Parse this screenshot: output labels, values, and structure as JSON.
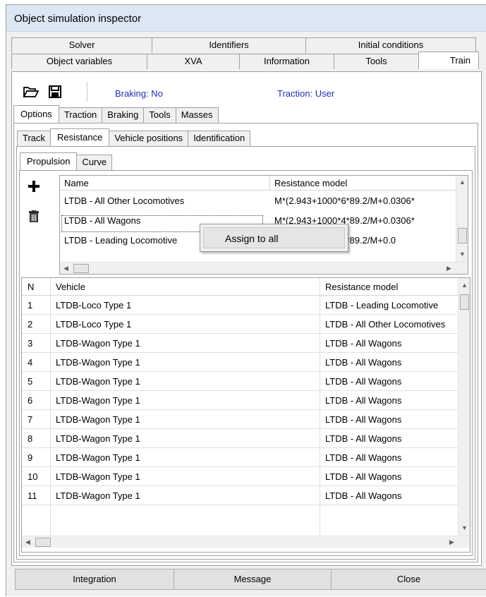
{
  "window": {
    "title": "Object simulation inspector"
  },
  "tabs_row1": [
    "Solver",
    "Identifiers",
    "Initial conditions"
  ],
  "tabs_row2": [
    "Object variables",
    "XVA",
    "Information",
    "Tools",
    "Train"
  ],
  "active_main_tab": "Train",
  "toolbar": {
    "open_icon": "folder-open-icon",
    "save_icon": "save-icon",
    "braking": "Braking: No",
    "traction": "Traction: User",
    "status_color": "#1c2fb5"
  },
  "tabs_level1": [
    "Options",
    "Traction",
    "Braking",
    "Tools",
    "Masses"
  ],
  "tabs_level2": [
    "Track",
    "Resistance",
    "Vehicle positions",
    "Identification"
  ],
  "tabs_level3": [
    "Propulsion",
    "Curve"
  ],
  "side_actions": {
    "add_icon": "plus-icon",
    "delete_icon": "trash-icon"
  },
  "resistance_table": {
    "headers": [
      "Name",
      "Resistance model"
    ],
    "rows": [
      [
        "LTDB - All Other Locomotives",
        "M*(2.943+1000*6*89.2/M+0.0306*"
      ],
      [
        "LTDB - All Wagons",
        "M*(2.943+1000*4*89.2/M+0.0306*"
      ],
      [
        "LTDB - Leading Locomotive",
        "M*(2.943+1000*6*89.2/M+0.0"
      ]
    ]
  },
  "context_menu": {
    "items": [
      "Assign to all"
    ]
  },
  "vehicle_table": {
    "headers": [
      "N",
      "Vehicle",
      "Resistance model"
    ],
    "rows": [
      [
        "1",
        "LTDB-Loco Type 1",
        "LTDB - Leading Locomotive"
      ],
      [
        "2",
        "LTDB-Loco Type 1",
        "LTDB - All Other Locomotives"
      ],
      [
        "3",
        "LTDB-Wagon Type 1",
        "LTDB - All Wagons"
      ],
      [
        "4",
        "LTDB-Wagon Type 1",
        "LTDB - All Wagons"
      ],
      [
        "5",
        "LTDB-Wagon Type 1",
        "LTDB - All Wagons"
      ],
      [
        "6",
        "LTDB-Wagon Type 1",
        "LTDB - All Wagons"
      ],
      [
        "7",
        "LTDB-Wagon Type 1",
        "LTDB - All Wagons"
      ],
      [
        "8",
        "LTDB-Wagon Type 1",
        "LTDB - All Wagons"
      ],
      [
        "9",
        "LTDB-Wagon Type 1",
        "LTDB - All Wagons"
      ],
      [
        "10",
        "LTDB-Wagon Type 1",
        "LTDB - All Wagons"
      ],
      [
        "11",
        "LTDB-Wagon Type 1",
        "LTDB - All Wagons"
      ]
    ]
  },
  "buttons": [
    "Integration",
    "Message",
    "Close"
  ]
}
